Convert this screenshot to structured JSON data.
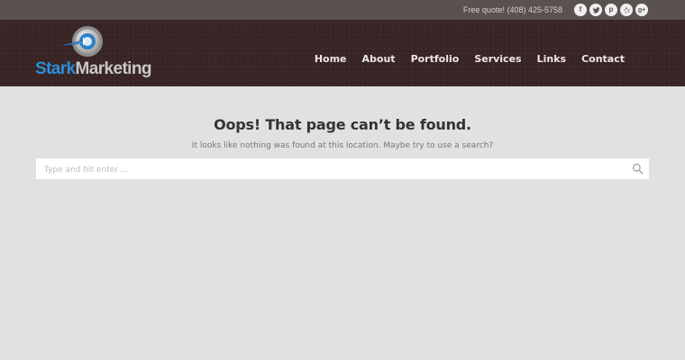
{
  "topbar": {
    "phone": "Free quote! (408) 425-5758",
    "social": [
      {
        "icon": "facebook-icon",
        "glyph": "f"
      },
      {
        "icon": "twitter-icon",
        "glyph": ""
      },
      {
        "icon": "pinterest-icon",
        "glyph": "p"
      },
      {
        "icon": "yelp-icon",
        "glyph": ""
      },
      {
        "icon": "google-plus-icon",
        "glyph": "g+"
      }
    ]
  },
  "header": {
    "logo": {
      "word1": "Stark",
      "word2": "Marketing"
    },
    "nav": [
      {
        "label": "Home"
      },
      {
        "label": "About"
      },
      {
        "label": "Portfolio"
      },
      {
        "label": "Services"
      },
      {
        "label": "Links"
      },
      {
        "label": "Contact"
      }
    ]
  },
  "main": {
    "title": "Oops! That page can’t be found.",
    "message": "It looks like nothing was found at this location. Maybe try to use a search?",
    "search": {
      "placeholder": "Type and hit enter ...",
      "value": ""
    }
  },
  "colors": {
    "topbar": "#5a5250",
    "header": "#3a2526",
    "body": "#e1e1e1",
    "logo_blue": "#2c8fd6"
  }
}
